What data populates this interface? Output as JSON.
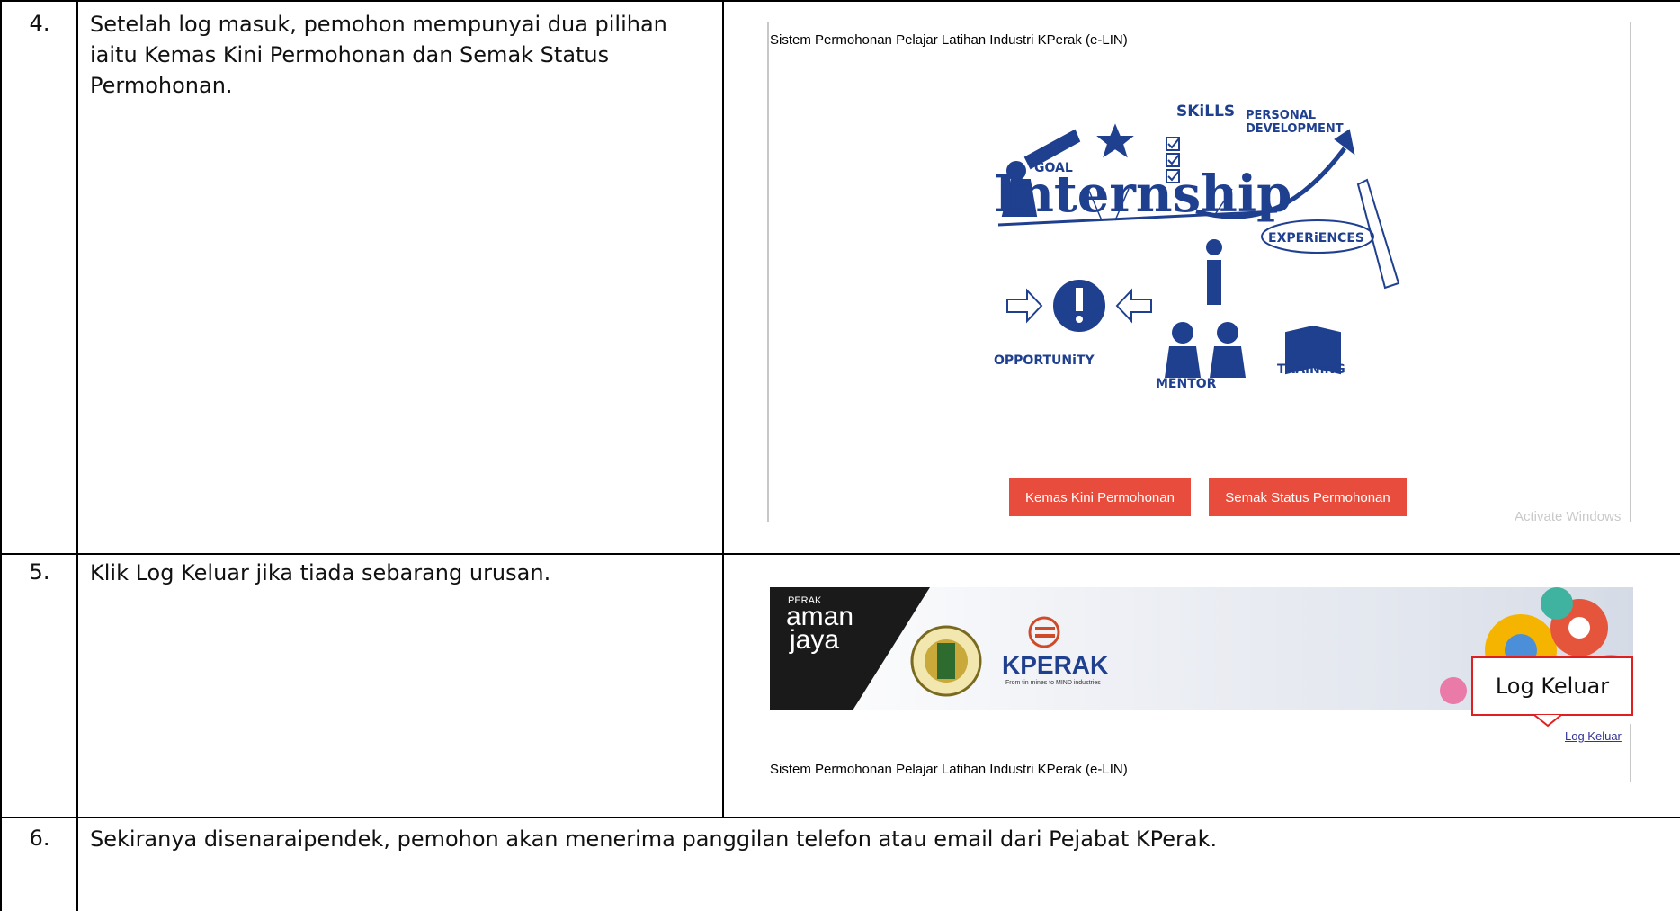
{
  "rows": [
    {
      "number": "4.",
      "text": "Setelah log masuk, pemohon mempunyai dua pilihan iaitu Kemas Kini Permohonan dan Semak Status Permohonan.",
      "screenshot": {
        "system_title": "Sistem Permohonan Pelajar Latihan Industri KPerak (e-LIN)",
        "illustration_words": {
          "main": "Internship",
          "skills": "SKiLLS",
          "personal": "PERSONAL",
          "development": "DEVELOPMENT",
          "goal": "GOAL",
          "experiences": "EXPERiENCES",
          "opportunity": "OPPORTUNiTY",
          "mentor": "MENTOR",
          "training": "TRAiNiNG"
        },
        "buttons": {
          "update": "Kemas Kini Permohonan",
          "status": "Semak Status Permohonan"
        },
        "watermark": "Activate Windows"
      }
    },
    {
      "number": "5.",
      "text": "Klik Log Keluar jika tiada sebarang urusan.",
      "screenshot": {
        "banner": {
          "perak": "PERAK",
          "aman": "aman",
          "jaya": "jaya",
          "kperak": "KPERAK",
          "tagline": "From tin mines to MIND industries"
        },
        "callout": "Log Keluar",
        "logout_link": "Log Keluar",
        "system_title": "Sistem Permohonan Pelajar Latihan Industri KPerak (e-LIN)"
      }
    },
    {
      "number": "6.",
      "text": "Sekiranya disenaraipendek, pemohon akan menerima panggilan telefon atau email dari Pejabat KPerak."
    }
  ],
  "colors": {
    "button_red": "#e74c3c",
    "illustration_blue": "#1f3f8f",
    "callout_border": "#e02020",
    "link": "#333399"
  }
}
